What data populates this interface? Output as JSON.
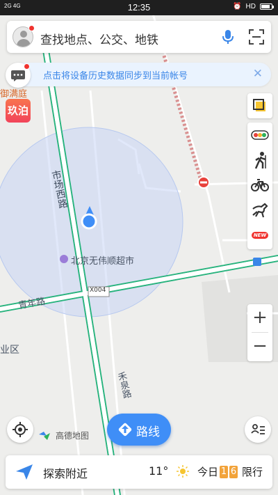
{
  "status_bar": {
    "signal": "2G 4G",
    "time": "12:35",
    "network_indicator": "HD",
    "battery_level": 0.85
  },
  "search": {
    "placeholder": "查找地点、公交、地铁",
    "mic_icon": "microphone-icon",
    "scan_icon": "scan-icon"
  },
  "notice": {
    "text": "点击将设备历史数据同步到当前帐号",
    "close": "✕"
  },
  "map": {
    "labels": {
      "poi_top": "御满庭",
      "road_west": "市场西路",
      "supermarket": "北京无伟顺超市",
      "road_qingnian": "青年路",
      "road_code": "X004",
      "district": "业区",
      "road_south": "禾泉路"
    },
    "app_icon_text": "玖泊",
    "colors": {
      "road_green": "#27b37d",
      "accent_blue": "#3f8ef7",
      "accuracy_circle": "#c8d6f5"
    }
  },
  "tools": [
    {
      "name": "layers",
      "icon": "layers-icon"
    },
    {
      "name": "traffic",
      "icon": "traffic-light-icon"
    },
    {
      "name": "walk",
      "icon": "walking-person-icon"
    },
    {
      "name": "bike",
      "icon": "bicycle-icon"
    },
    {
      "name": "horse",
      "icon": "horse-icon"
    },
    {
      "name": "new",
      "label": "NEW"
    }
  ],
  "zoom": {
    "in": "+",
    "out": "−"
  },
  "brand": {
    "name": "高德地图"
  },
  "route_button": {
    "label": "路线"
  },
  "bottom_bar": {
    "explore": "探索附近",
    "temperature": "11°",
    "today": "今日",
    "plate_1": "1",
    "plate_2": "6",
    "restriction": "限行"
  }
}
